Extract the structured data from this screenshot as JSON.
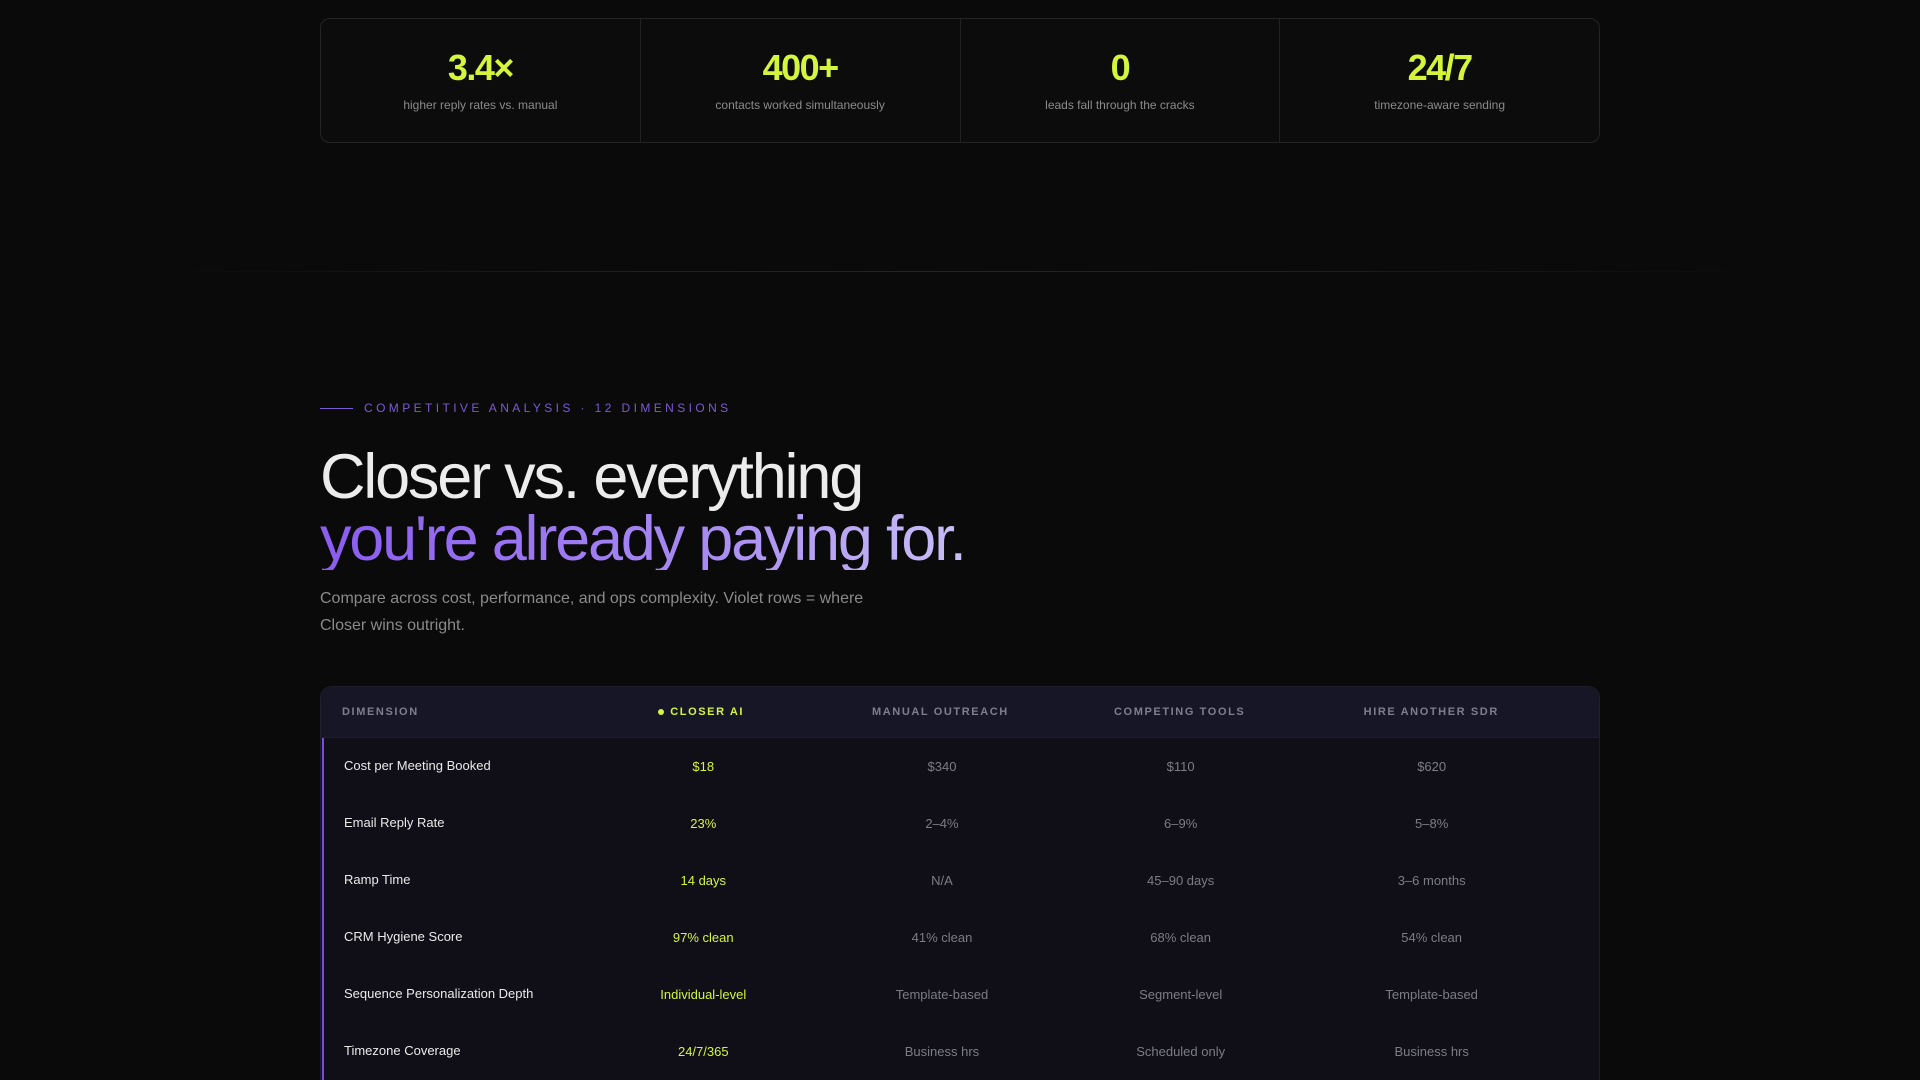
{
  "stats": [
    {
      "value": "3.4×",
      "label": "higher reply rates vs. manual"
    },
    {
      "value": "400+",
      "label": "contacts worked simultaneously"
    },
    {
      "value": "0",
      "label": "leads fall through the cracks"
    },
    {
      "value": "24/7",
      "label": "timezone-aware sending"
    }
  ],
  "section": {
    "eyebrow": "COMPETITIVE ANALYSIS · 12 DIMENSIONS",
    "headline_line1": "Closer vs. everything",
    "headline_line2": "you're already paying for.",
    "subtitle": "Compare across cost, performance, and ops complexity. Violet rows = where Closer wins outright."
  },
  "table": {
    "headers": [
      "DIMENSION",
      "CLOSER AI",
      "MANUAL OUTREACH",
      "COMPETING TOOLS",
      "HIRE ANOTHER SDR"
    ],
    "rows": [
      [
        "Cost per Meeting Booked",
        "$18",
        "$340",
        "$110",
        "$620"
      ],
      [
        "Email Reply Rate",
        "23%",
        "2–4%",
        "6–9%",
        "5–8%"
      ],
      [
        "Ramp Time",
        "14 days",
        "N/A",
        "45–90 days",
        "3–6 months"
      ],
      [
        "CRM Hygiene Score",
        "97% clean",
        "41% clean",
        "68% clean",
        "54% clean"
      ],
      [
        "Sequence Personalization Depth",
        "Individual-level",
        "Template-based",
        "Segment-level",
        "Template-based"
      ],
      [
        "Timezone Coverage",
        "24/7/365",
        "Business hrs",
        "Scheduled only",
        "Business hrs"
      ]
    ]
  },
  "colors": {
    "accent_lime": "#d4f53c",
    "accent_violet": "#7a4fe0",
    "background": "#0a0a0a"
  }
}
